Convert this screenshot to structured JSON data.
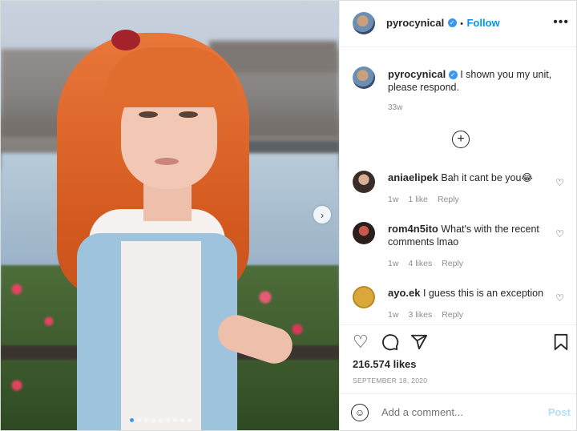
{
  "post": {
    "author": "pyrocynical",
    "follow_label": "Follow",
    "separator": "•",
    "more_label": "•••",
    "caption": "I shown you my unit, please respond.",
    "caption_time": "33w",
    "load_more_icon": "plus-circle-icon",
    "carousel": {
      "next_icon": "chevron-right-icon",
      "dots": 9,
      "active_dot": 1
    }
  },
  "comments": [
    {
      "user": "aniaelipek",
      "text": "Bah it cant be you😂",
      "time": "1w",
      "likes": "1 like",
      "reply": "Reply"
    },
    {
      "user": "rom4n5ito",
      "text": "What's with the recent comments lmao",
      "time": "1w",
      "likes": "4 likes",
      "reply": "Reply"
    },
    {
      "user": "ayo.ek",
      "text": "I guess this is an exception",
      "time": "1w",
      "likes": "3 likes",
      "reply": "Reply"
    }
  ],
  "actions": {
    "like_icon": "heart-icon",
    "comment_icon": "comment-icon",
    "share_icon": "paper-plane-icon",
    "save_icon": "bookmark-icon",
    "likes": "216.574 likes",
    "date": "SEPTEMBER 18, 2020"
  },
  "add_comment": {
    "placeholder": "Add a comment...",
    "post_label": "Post",
    "emoji_icon": "smiley-icon"
  },
  "colors": {
    "accent": "#0095f6",
    "verified": "#3897f0",
    "post_disabled": "#b2dffc"
  }
}
